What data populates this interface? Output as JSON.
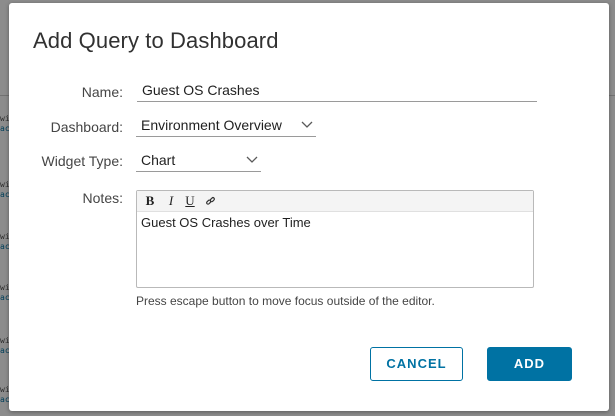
{
  "dialog": {
    "title": "Add Query to Dashboard"
  },
  "form": {
    "name": {
      "label": "Name:",
      "value": "Guest OS Crashes"
    },
    "dashboard": {
      "label": "Dashboard:",
      "selected": "Environment Overview"
    },
    "widget_type": {
      "label": "Widget Type:",
      "selected": "Chart"
    },
    "notes": {
      "label": "Notes:",
      "toolbar": {
        "bold": "B",
        "italic": "I",
        "underline": "U",
        "link_icon": "link-icon"
      },
      "content": "Guest OS Crashes over Time",
      "hint": "Press escape button to move focus outside of the editor."
    }
  },
  "buttons": {
    "cancel": "CANCEL",
    "add": "ADD"
  },
  "colors": {
    "primary": "#0072a3",
    "overlay": "rgba(0,0,0,0.45)"
  }
}
